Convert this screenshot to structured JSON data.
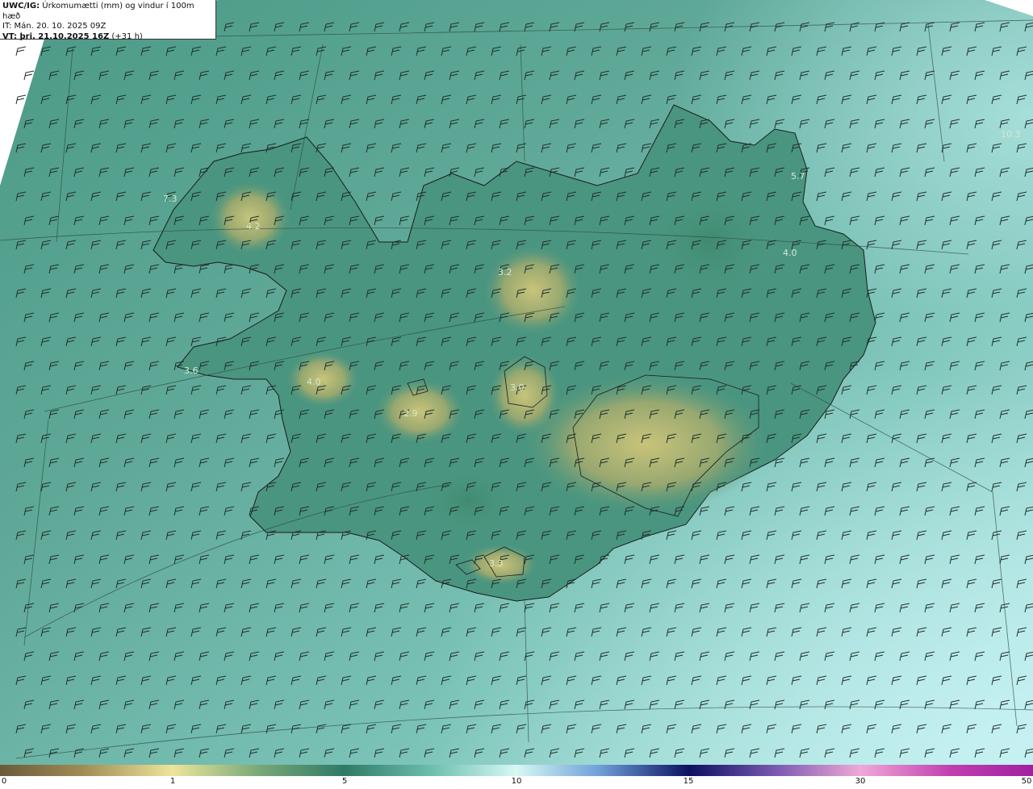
{
  "header": {
    "model": "UWC/IG:",
    "title": "Úrkomumætti (mm) og vindur í 100m hæð",
    "issue_time": "IT: Mán. 20. 10. 2025 09Z",
    "valid_label": "VT: þri. 21.10.2025 16Z",
    "valid_offset": "(+31 h)"
  },
  "map_values": [
    {
      "id": "val-1",
      "text": "7.3"
    },
    {
      "id": "val-2",
      "text": "4.2"
    },
    {
      "id": "val-3",
      "text": "3.2"
    },
    {
      "id": "val-4",
      "text": "4.0"
    },
    {
      "id": "val-5",
      "text": "3.6"
    },
    {
      "id": "val-6",
      "text": "4.0"
    },
    {
      "id": "val-7",
      "text": "2.9"
    },
    {
      "id": "val-8",
      "text": "3.0"
    },
    {
      "id": "val-9",
      "text": "3.3"
    },
    {
      "id": "val-10",
      "text": "10.3"
    },
    {
      "id": "val-11",
      "text": "5.7"
    }
  ],
  "colorbar": {
    "ticks": [
      "0",
      "1",
      "5",
      "10",
      "15",
      "30",
      "50"
    ],
    "colors": [
      "#6b5a3a",
      "#c9c06e",
      "#ede59a",
      "#4f8f78",
      "#2f7a66",
      "#8fd8cf",
      "#d8f8f4",
      "#6fa0d8",
      "#1c2890",
      "#0c1060",
      "#b070c0",
      "#f0a8d8",
      "#c040b0",
      "#a020a0"
    ]
  }
}
